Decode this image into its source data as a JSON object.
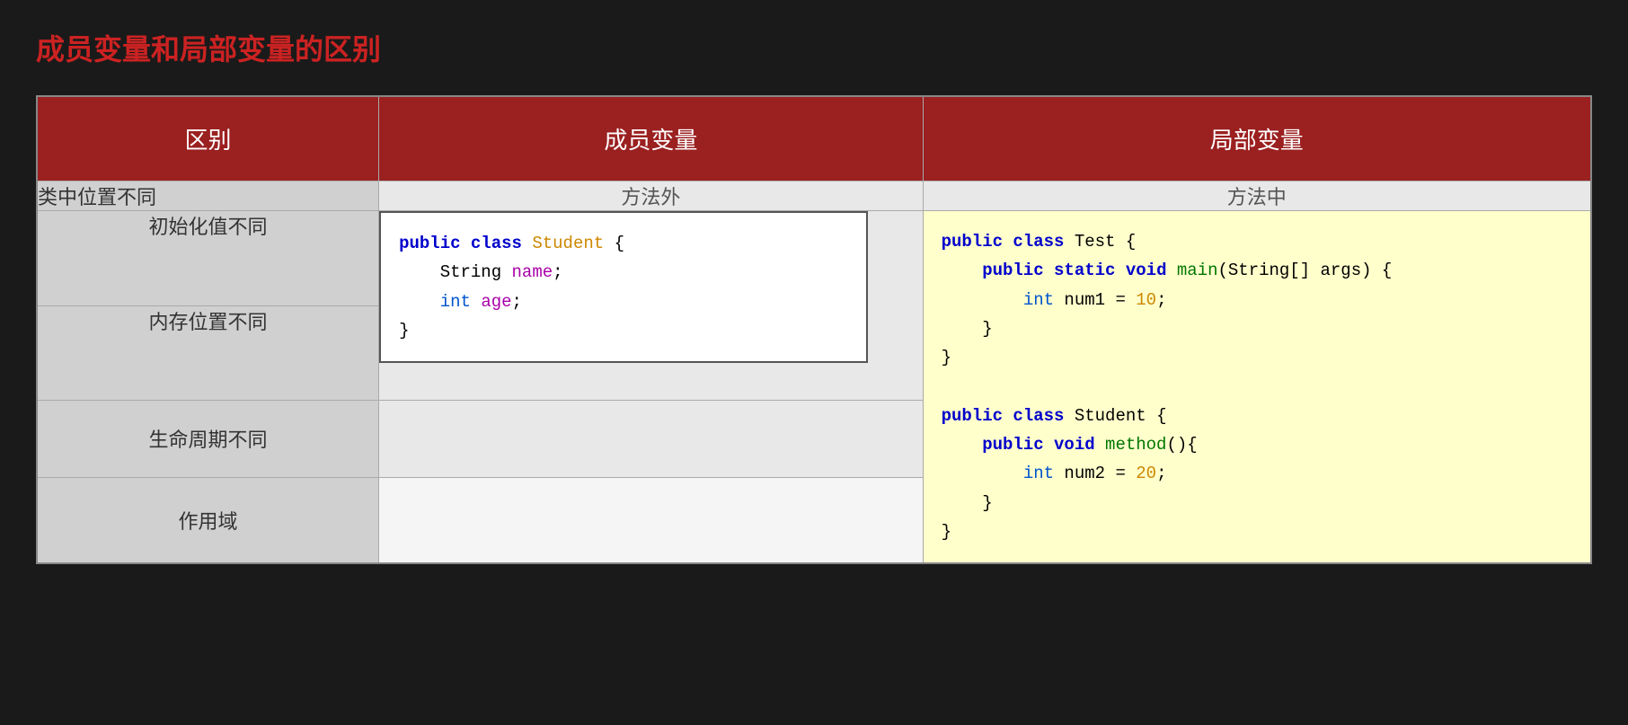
{
  "page": {
    "title": "成员变量和局部变量的区别",
    "table": {
      "headers": [
        "区别",
        "成员变量",
        "局部变量"
      ],
      "rows": [
        {
          "label": "类中位置不同",
          "member": "方法外",
          "local": "方法中"
        }
      ],
      "code_row": {
        "member_code": {
          "line1_kw1": "public",
          "line1_kw2": "class",
          "line1_name": "Student",
          "line1_rest": " {",
          "line2_indent": "    ",
          "line2_type": "String",
          "line2_var": " name",
          "line2_end": ";",
          "line3_indent": "    ",
          "line3_kw": "int",
          "line3_var": " age",
          "line3_end": ";",
          "line4": "}"
        },
        "local_code": {
          "line1_kw1": "public",
          "line1_kw2": "class",
          "line1_name": "Test",
          "line1_rest": " {",
          "line2_indent": "    ",
          "line2_kw1": "public",
          "line2_kw2": "static",
          "line2_kw3": "void",
          "line2_method": "main",
          "line2_rest": "(String[] args) {",
          "line3_indent": "        ",
          "line3_kw": "int",
          "line3_rest": " num1 = ",
          "line3_val": "10",
          "line3_end": ";",
          "line4_indent": "    }",
          "line5": "}",
          "line6": "",
          "line7_kw1": "public",
          "line7_kw2": "class",
          "line7_name": "Student",
          "line7_rest": " {",
          "line8_indent": "    ",
          "line8_kw1": "public",
          "line8_kw2": "void",
          "line8_method": "method",
          "line8_rest": "(){",
          "line9_indent": "        ",
          "line9_kw": "int",
          "line9_rest": " num2 = ",
          "line9_val": "20",
          "line9_end": ";",
          "line10_indent": "    }",
          "line11": "}"
        }
      },
      "bottom_rows": [
        {
          "label": "生命周期不同"
        },
        {
          "label": "作用域"
        }
      ]
    }
  }
}
